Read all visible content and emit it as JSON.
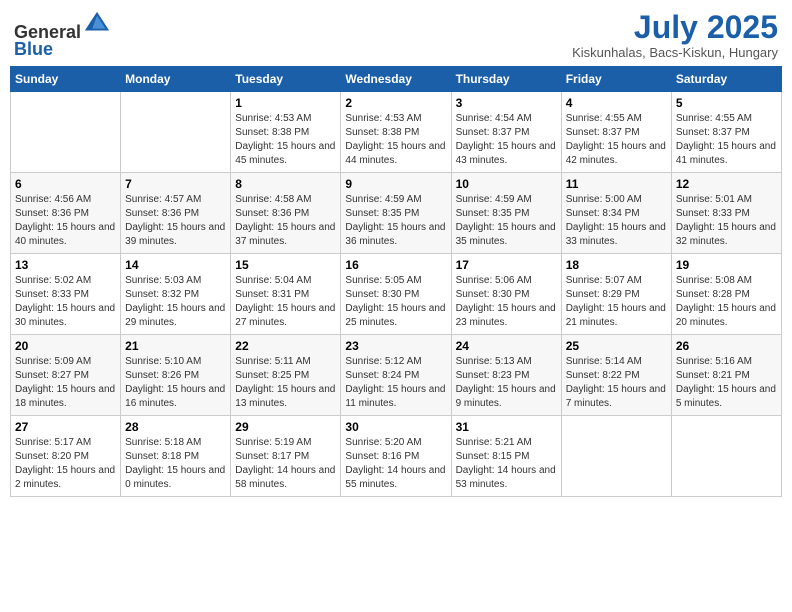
{
  "header": {
    "logo": {
      "general": "General",
      "blue": "Blue"
    },
    "title": "July 2025",
    "location": "Kiskunhalas, Bacs-Kiskun, Hungary"
  },
  "weekdays": [
    "Sunday",
    "Monday",
    "Tuesday",
    "Wednesday",
    "Thursday",
    "Friday",
    "Saturday"
  ],
  "weeks": [
    [
      null,
      null,
      {
        "day": 1,
        "sunrise": "4:53 AM",
        "sunset": "8:38 PM",
        "daylight": "15 hours and 45 minutes."
      },
      {
        "day": 2,
        "sunrise": "4:53 AM",
        "sunset": "8:38 PM",
        "daylight": "15 hours and 44 minutes."
      },
      {
        "day": 3,
        "sunrise": "4:54 AM",
        "sunset": "8:37 PM",
        "daylight": "15 hours and 43 minutes."
      },
      {
        "day": 4,
        "sunrise": "4:55 AM",
        "sunset": "8:37 PM",
        "daylight": "15 hours and 42 minutes."
      },
      {
        "day": 5,
        "sunrise": "4:55 AM",
        "sunset": "8:37 PM",
        "daylight": "15 hours and 41 minutes."
      }
    ],
    [
      {
        "day": 6,
        "sunrise": "4:56 AM",
        "sunset": "8:36 PM",
        "daylight": "15 hours and 40 minutes."
      },
      {
        "day": 7,
        "sunrise": "4:57 AM",
        "sunset": "8:36 PM",
        "daylight": "15 hours and 39 minutes."
      },
      {
        "day": 8,
        "sunrise": "4:58 AM",
        "sunset": "8:36 PM",
        "daylight": "15 hours and 37 minutes."
      },
      {
        "day": 9,
        "sunrise": "4:59 AM",
        "sunset": "8:35 PM",
        "daylight": "15 hours and 36 minutes."
      },
      {
        "day": 10,
        "sunrise": "4:59 AM",
        "sunset": "8:35 PM",
        "daylight": "15 hours and 35 minutes."
      },
      {
        "day": 11,
        "sunrise": "5:00 AM",
        "sunset": "8:34 PM",
        "daylight": "15 hours and 33 minutes."
      },
      {
        "day": 12,
        "sunrise": "5:01 AM",
        "sunset": "8:33 PM",
        "daylight": "15 hours and 32 minutes."
      }
    ],
    [
      {
        "day": 13,
        "sunrise": "5:02 AM",
        "sunset": "8:33 PM",
        "daylight": "15 hours and 30 minutes."
      },
      {
        "day": 14,
        "sunrise": "5:03 AM",
        "sunset": "8:32 PM",
        "daylight": "15 hours and 29 minutes."
      },
      {
        "day": 15,
        "sunrise": "5:04 AM",
        "sunset": "8:31 PM",
        "daylight": "15 hours and 27 minutes."
      },
      {
        "day": 16,
        "sunrise": "5:05 AM",
        "sunset": "8:30 PM",
        "daylight": "15 hours and 25 minutes."
      },
      {
        "day": 17,
        "sunrise": "5:06 AM",
        "sunset": "8:30 PM",
        "daylight": "15 hours and 23 minutes."
      },
      {
        "day": 18,
        "sunrise": "5:07 AM",
        "sunset": "8:29 PM",
        "daylight": "15 hours and 21 minutes."
      },
      {
        "day": 19,
        "sunrise": "5:08 AM",
        "sunset": "8:28 PM",
        "daylight": "15 hours and 20 minutes."
      }
    ],
    [
      {
        "day": 20,
        "sunrise": "5:09 AM",
        "sunset": "8:27 PM",
        "daylight": "15 hours and 18 minutes."
      },
      {
        "day": 21,
        "sunrise": "5:10 AM",
        "sunset": "8:26 PM",
        "daylight": "15 hours and 16 minutes."
      },
      {
        "day": 22,
        "sunrise": "5:11 AM",
        "sunset": "8:25 PM",
        "daylight": "15 hours and 13 minutes."
      },
      {
        "day": 23,
        "sunrise": "5:12 AM",
        "sunset": "8:24 PM",
        "daylight": "15 hours and 11 minutes."
      },
      {
        "day": 24,
        "sunrise": "5:13 AM",
        "sunset": "8:23 PM",
        "daylight": "15 hours and 9 minutes."
      },
      {
        "day": 25,
        "sunrise": "5:14 AM",
        "sunset": "8:22 PM",
        "daylight": "15 hours and 7 minutes."
      },
      {
        "day": 26,
        "sunrise": "5:16 AM",
        "sunset": "8:21 PM",
        "daylight": "15 hours and 5 minutes."
      }
    ],
    [
      {
        "day": 27,
        "sunrise": "5:17 AM",
        "sunset": "8:20 PM",
        "daylight": "15 hours and 2 minutes."
      },
      {
        "day": 28,
        "sunrise": "5:18 AM",
        "sunset": "8:18 PM",
        "daylight": "15 hours and 0 minutes."
      },
      {
        "day": 29,
        "sunrise": "5:19 AM",
        "sunset": "8:17 PM",
        "daylight": "14 hours and 58 minutes."
      },
      {
        "day": 30,
        "sunrise": "5:20 AM",
        "sunset": "8:16 PM",
        "daylight": "14 hours and 55 minutes."
      },
      {
        "day": 31,
        "sunrise": "5:21 AM",
        "sunset": "8:15 PM",
        "daylight": "14 hours and 53 minutes."
      },
      null,
      null
    ]
  ]
}
